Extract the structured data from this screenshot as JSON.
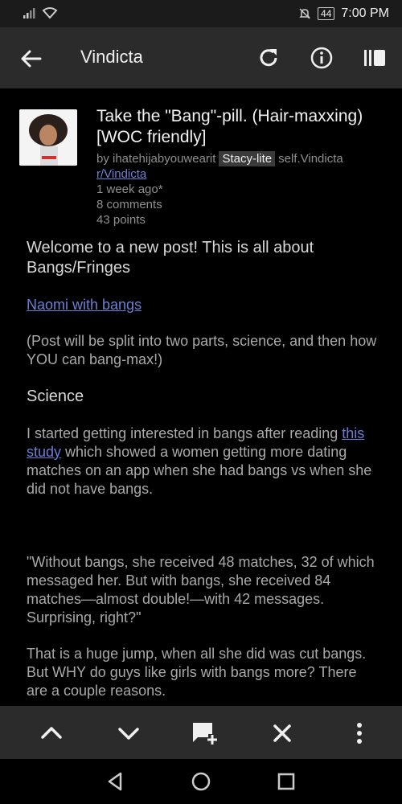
{
  "status": {
    "battery": "44",
    "time": "7:00 PM"
  },
  "appbar": {
    "title": "Vindicta"
  },
  "post": {
    "title": "Take the \"Bang\"-pill. (Hair-maxxing) [WOC friendly]",
    "by_text": "by ihatehijabyouwearit",
    "flair": "Stacy-lite",
    "domain": "self.Vindicta",
    "subreddit": "r/Vindicta",
    "age": "1 week ago*",
    "comments": "8 comments",
    "points": "43 points"
  },
  "body": {
    "heading1": "Welcome to a new post! This is all about Bangs/Fringes",
    "link1": "Naomi with bangs",
    "para1": "(Post will be split into two parts, science, and then how YOU can bang-max!)",
    "heading2": "Science",
    "para2_start": "I started getting interested in bangs after reading ",
    "para2_link": "this study",
    "para2_end": " which showed a women getting more dating matches on an app when she had bangs vs when she did not have bangs.",
    "quote": "\"Without bangs, she received 48 matches, 32 of which messaged her. But with bangs, she received 84 matches—almost double!—with 42 messages. Surprising, right?\"",
    "para3": "That is a huge jump, when all she did was cut bangs. But WHY do guys like girls with bangs more? There are a couple reasons."
  },
  "icons": [
    "signal-icon",
    "wifi-icon",
    "mute-icon",
    "battery-icon",
    "back-arrow-icon",
    "refresh-icon",
    "info-icon",
    "sidebar-icon",
    "chevron-up-icon",
    "chevron-down-icon",
    "add-comment-icon",
    "close-icon",
    "more-vert-icon",
    "nav-back-icon",
    "nav-home-icon",
    "nav-recents-icon"
  ]
}
